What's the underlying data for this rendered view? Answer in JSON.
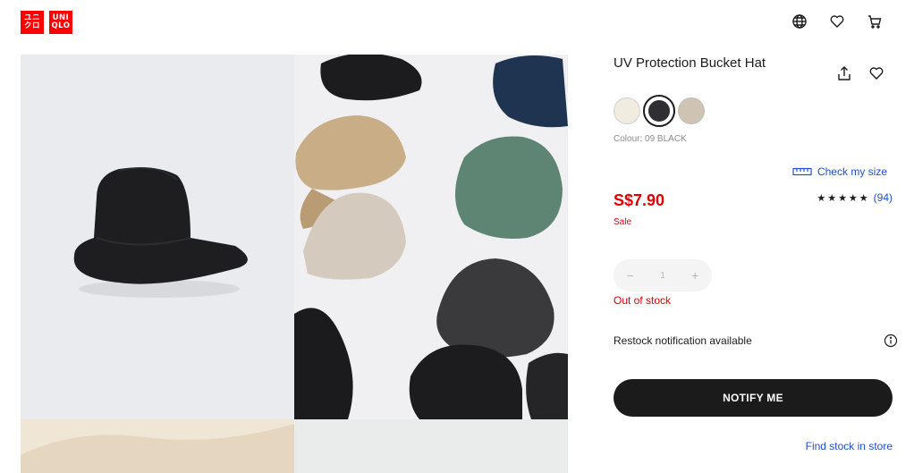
{
  "header": {
    "logo": {
      "line1a": "ユニ",
      "line1b": "クロ",
      "line2a": "UNI",
      "line2b": "QLO",
      "color": "#ff0000"
    },
    "icons": [
      "globe-icon",
      "heart-icon",
      "cart-icon"
    ]
  },
  "gallery": {
    "images": [
      "black-bucket-hat",
      "hats-flatlay",
      "beige-detail",
      "grey-detail"
    ]
  },
  "product": {
    "title": "UV Protection Bucket Hat",
    "colour_label": "Colour: 09 BLACK",
    "swatches": [
      {
        "color": "#f1ece0",
        "selected": false
      },
      {
        "color": "#2e2e33",
        "selected": true
      },
      {
        "color": "#cfc3b3",
        "selected": false
      }
    ],
    "check_size": "Check my size",
    "price": "S$7.90",
    "sale": "Sale",
    "stars": "★★★★★",
    "review_count": "(94)",
    "quantity": "1",
    "minus": "−",
    "plus": "+",
    "stock_status": "Out of stock",
    "restock": "Restock notification available",
    "notify_button": "NOTIFY ME",
    "find_stock": "Find stock in store"
  },
  "colors": {
    "accent_red": "#e00000",
    "link_blue": "#1e4fd0",
    "button_dark": "#1b1b1b"
  }
}
